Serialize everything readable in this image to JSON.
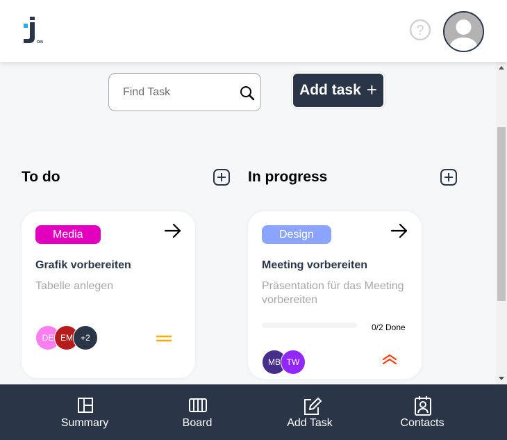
{
  "header": {
    "logo_icon": "join-logo-icon",
    "logo_text": "OIN",
    "help_icon": "question-circle-icon",
    "avatar_icon": "user-avatar-icon"
  },
  "toolbar": {
    "search_placeholder": "Find Task",
    "search_icon": "search-icon",
    "add_task_label": "Add task",
    "add_task_icon": "plus-icon"
  },
  "columns": [
    {
      "title": "To do",
      "cards": [
        {
          "category": "Media",
          "category_color": "#e200be",
          "title": "Grafik vorbereiten",
          "description": "Tabelle anlegen",
          "assignees": [
            {
              "initials": "DE",
              "color": "#ff7eef"
            },
            {
              "initials": "EM",
              "color": "#b71c1c"
            },
            {
              "initials": "+2",
              "color": "#2a3647"
            }
          ],
          "priority": "medium",
          "priority_color": "#ffa800"
        }
      ]
    },
    {
      "title": "In progress",
      "cards": [
        {
          "category": "Design",
          "category_color": "#8aa4ff",
          "title": "Meeting vorbereiten",
          "description": "Präsentation für das Meeting vorbereiten",
          "subtasks_done": 0,
          "subtasks_total": 2,
          "progress_text": "0/2 Done",
          "assignees": [
            {
              "initials": "MB",
              "color": "#462f8a"
            },
            {
              "initials": "TW",
              "color": "#9327ff"
            }
          ],
          "priority": "urgent",
          "priority_color": "#ff3d00"
        }
      ]
    }
  ],
  "nav": [
    {
      "label": "Summary",
      "icon": "summary-icon"
    },
    {
      "label": "Board",
      "icon": "board-icon"
    },
    {
      "label": "Add Task",
      "icon": "edit-icon"
    },
    {
      "label": "Contacts",
      "icon": "contacts-icon"
    }
  ],
  "colors": {
    "primary": "#2a3647",
    "accent": "#29abe2",
    "background": "#f6f7f8"
  }
}
